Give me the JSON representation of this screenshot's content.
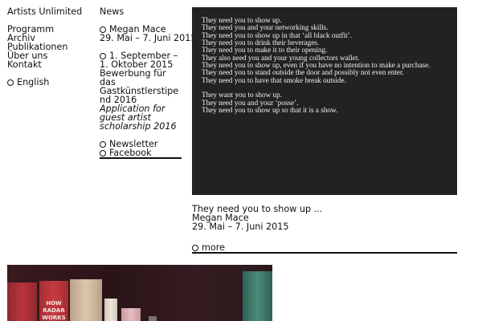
{
  "site": {
    "title": "Artists Unlimited"
  },
  "nav": {
    "items": [
      "Programm",
      "Archiv",
      "Publikationen",
      "Über uns",
      "Kontakt"
    ],
    "language": "English"
  },
  "news": {
    "heading": "News",
    "items": [
      {
        "title": "Megan Mace",
        "dates": "29. Mai – 7. Juni 2015"
      },
      {
        "dates": "1. September – 1. Oktober 2015",
        "title": "Bewerbung für das Gastkünstlerstipend 2016",
        "subtitle": "Application for guest artist scholarship 2016"
      }
    ],
    "links": [
      "Newsletter",
      "Facebook"
    ]
  },
  "feature": {
    "poem_stanza_1": [
      "They need you to show up.",
      "They need you and your networking skills.",
      "They need you to show up in that ‘all black outfit’.",
      "They need you to drink their beverages.",
      "They need you to make it to their opening.",
      "They also need you and your young collectors wallet.",
      "They need you to show up, even if you have no intention to make a purchase.",
      "They need you to stand outside the door and possibly not even enter.",
      "They need you to have that smoke break outside."
    ],
    "poem_stanza_2": [
      "They want you to show up.",
      "They need you and your ‘posse’.",
      "They need you to show up so that it is a show."
    ],
    "caption_title": "They need you to show up ...",
    "artist": "Megan Mace",
    "dates": "29. Mai – 7. Juni 2015",
    "more_label": "more"
  },
  "photo": {
    "book_spines": [
      "HOW",
      "RADAR",
      "WORKS"
    ],
    "colors": {
      "background": "#2e161a",
      "red_book": "#b9343a",
      "cream_book": "#d8c2a8",
      "teal_book": "#3f7a6a"
    }
  }
}
